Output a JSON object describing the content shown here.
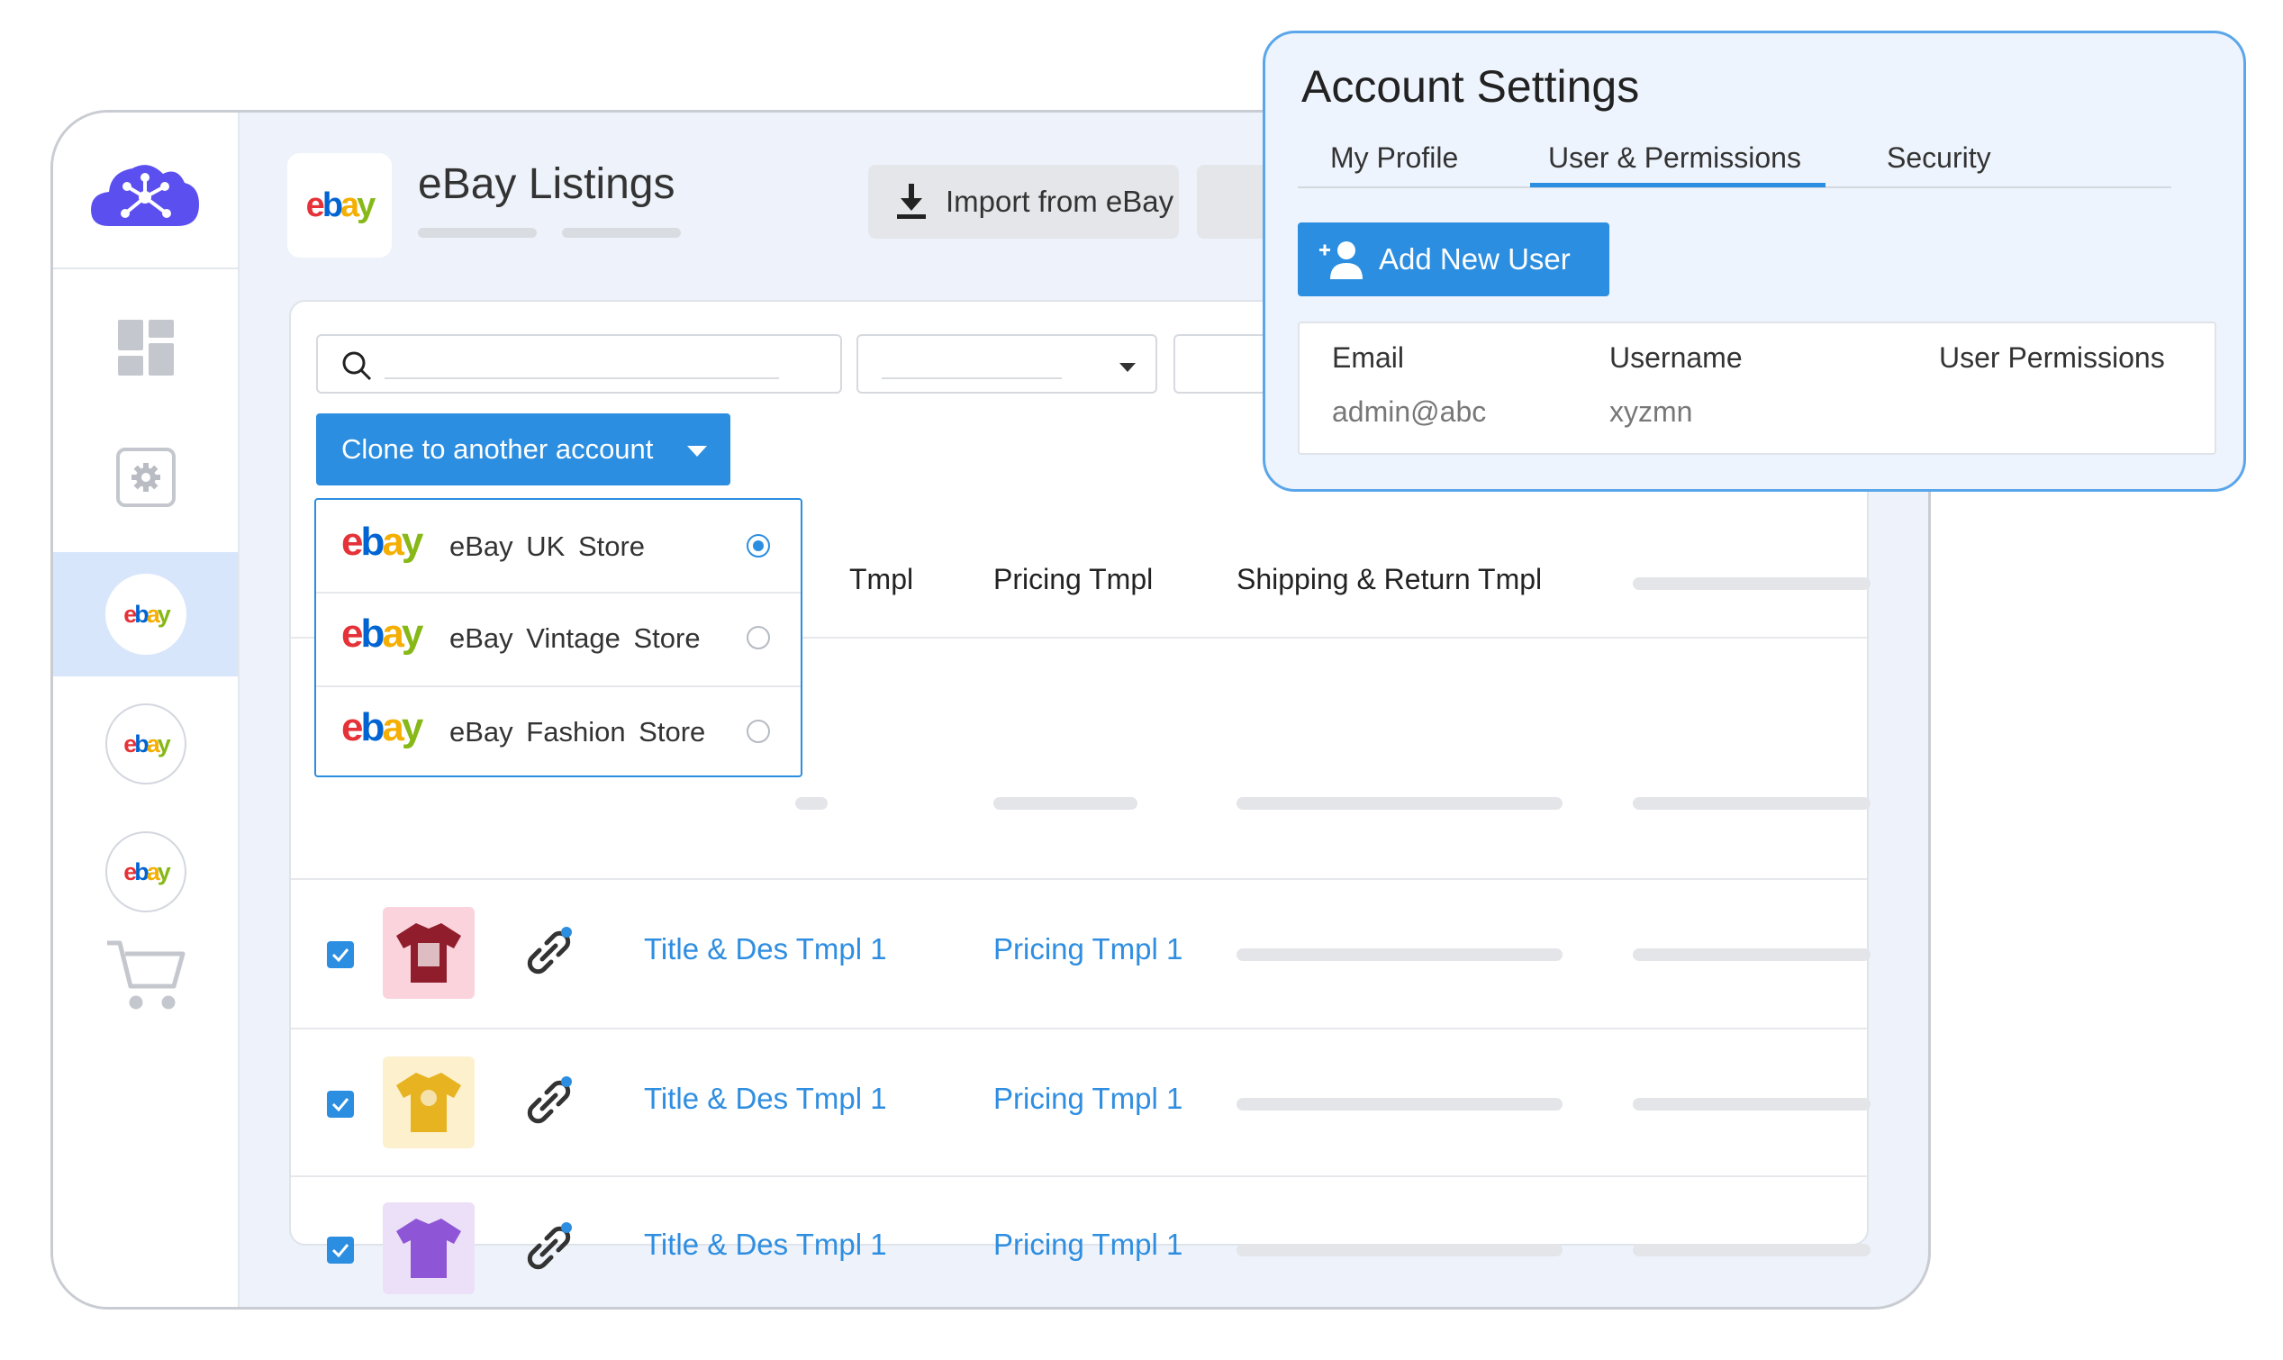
{
  "header": {
    "title": "eBay Listings",
    "logo_text": "ebay",
    "import_label": "Import from eBay"
  },
  "sidebar": {
    "items": [
      {
        "name": "dashboard",
        "icon": "dashboard-icon"
      },
      {
        "name": "settings",
        "icon": "settings-icon"
      },
      {
        "name": "ebay-store-1",
        "icon": "ebay-logo",
        "active": true
      },
      {
        "name": "ebay-store-2",
        "icon": "ebay-logo"
      },
      {
        "name": "ebay-store-3",
        "icon": "ebay-logo"
      },
      {
        "name": "cart",
        "icon": "cart-icon"
      }
    ],
    "logo_icon": "cloud-network-icon"
  },
  "toolbar": {
    "clone_label": "Clone to another account"
  },
  "dropdown": {
    "options": [
      {
        "label": "eBay UK  Store",
        "selected": true
      },
      {
        "label": "eBay Vintage  Store",
        "selected": false
      },
      {
        "label": "eBay Fashion  Store",
        "selected": false
      }
    ]
  },
  "table": {
    "headers": [
      "Tmpl",
      "Pricing Tmpl",
      "Shipping & Return Tmpl"
    ],
    "rows": [
      {
        "checked": true,
        "shirt_color": "#8f1d2c",
        "bg": "#fbd3dc",
        "title_tmpl": "Title & Des Tmpl 1",
        "pricing_tmpl": "Pricing Tmpl 1"
      },
      {
        "checked": true,
        "shirt_color": "#e8b320",
        "bg": "#fdf0cd",
        "title_tmpl": "Title & Des Tmpl 1",
        "pricing_tmpl": "Pricing Tmpl 1"
      },
      {
        "checked": true,
        "shirt_color": "#8e55d6",
        "bg": "#ecdff8",
        "title_tmpl": "Title & Des Tmpl 1",
        "pricing_tmpl": "Pricing Tmpl 1"
      }
    ]
  },
  "account_settings": {
    "title": "Account Settings",
    "tabs": [
      "My Profile",
      "User & Permissions",
      "Security"
    ],
    "active_tab": "User & Permissions",
    "add_user_label": "Add New User",
    "columns": [
      "Email",
      "Username",
      "User Permissions"
    ],
    "user": {
      "email": "admin@abc",
      "username": "xyzmn"
    }
  },
  "colors": {
    "accent": "#2b8ee0",
    "ebay_red": "#e53238",
    "ebay_blue": "#0064d2",
    "ebay_yellow": "#f5af02",
    "ebay_green": "#86b817"
  }
}
